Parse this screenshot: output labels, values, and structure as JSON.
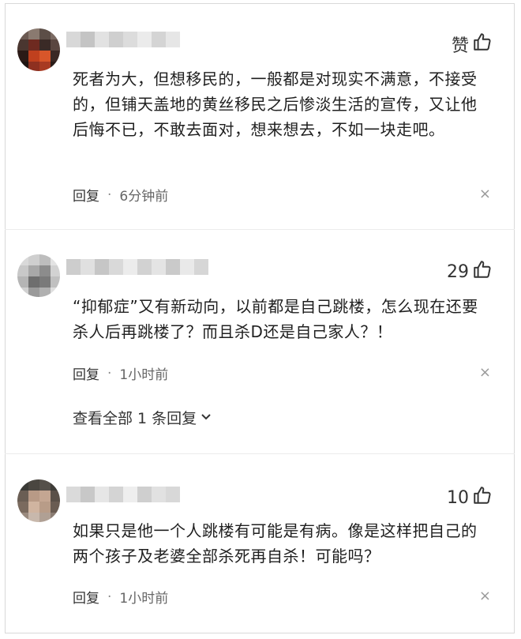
{
  "comments": [
    {
      "like_label": "赞",
      "text": "死者为大，但想移民的，一般都是对现实不满意，不接受的，但铺天盖地的黄丝移民之后惨淡生活的宣传，又让他后悔不已，不敢去面对，想来想去，不如一块走吧。",
      "reply_label": "回复",
      "separator": "·",
      "time": "6分钟前",
      "close_symbol": "×"
    },
    {
      "like_label": "29",
      "text": "“抑郁症”又有新动向，以前都是自己跳楼，怎么现在还要杀人后再跳楼了？而且杀D还是自己家人？！",
      "reply_label": "回复",
      "separator": "·",
      "time": "1小时前",
      "close_symbol": "×",
      "more_replies": "查看全部 1 条回复"
    },
    {
      "like_label": "10",
      "text": "如果只是他一个人跳楼有可能是有病。像是这样把自己的两个孩子及老婆全部杀死再自杀！可能吗？",
      "reply_label": "回复",
      "separator": "·",
      "time": "1小时前",
      "close_symbol": "×"
    }
  ],
  "icons": {
    "like": "thumbs-up-icon",
    "chevron": "chevron-down-icon"
  }
}
